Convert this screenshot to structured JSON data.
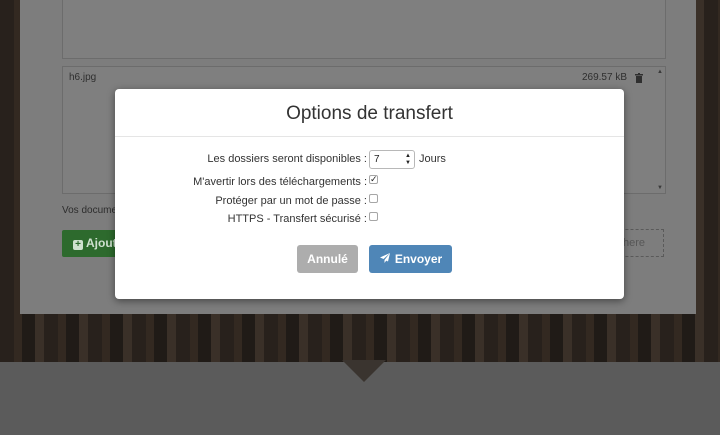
{
  "file": {
    "name": "h6.jpg",
    "size": "269.57 kB"
  },
  "background": {
    "vos_docs_text": "Vos docume",
    "add_button": "Ajout",
    "drop_button": "here"
  },
  "modal": {
    "title": "Options de transfert",
    "options": [
      {
        "label": "Les dossiers seront disponibles :",
        "value": "7",
        "unit": "Jours"
      },
      {
        "label": "M'avertir lors des téléchargements :",
        "checked": true
      },
      {
        "label": "Protéger par un mot de passe :",
        "checked": false
      },
      {
        "label": "HTTPS - Transfert sécurisé :",
        "checked": false
      }
    ],
    "cancel_label": "Annulé",
    "send_label": "Envoyer"
  },
  "colors": {
    "send": "#4f86b7",
    "cancel": "#adadad",
    "add": "#2d6a2d"
  }
}
